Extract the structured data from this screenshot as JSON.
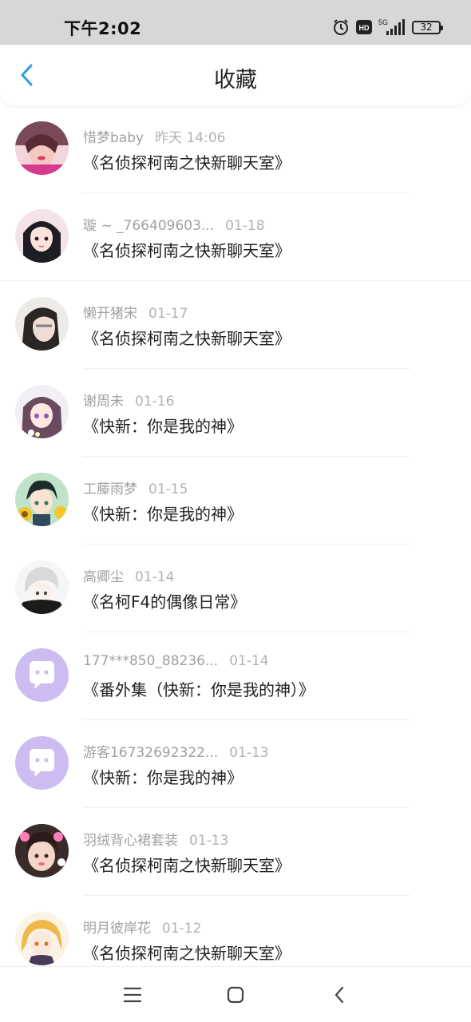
{
  "status_bar": {
    "time": "下午2:02",
    "network": "5G",
    "hd": "HD",
    "battery": "32"
  },
  "header": {
    "title": "收藏"
  },
  "colors": {
    "accent": "#2f9ae8",
    "title_text": "#222222",
    "meta_text": "#a0a0a0",
    "default_avatar": "#cdbcf2"
  },
  "items": [
    {
      "name": "惜梦baby",
      "date": "昨天 14:06",
      "title": "《名侦探柯南之快新聊天室》",
      "avatar": "photo-avatar"
    },
    {
      "name": "璇 ~ _766409603...",
      "date": "01-18",
      "title": "《名侦探柯南之快新聊天室》",
      "avatar": "anime-girl-avatar"
    },
    {
      "name": "懒开猪宋",
      "date": "01-17",
      "title": "《名侦探柯南之快新聊天室》",
      "avatar": "photo-avatar"
    },
    {
      "name": "谢周未",
      "date": "01-16",
      "title": "《快新：你是我的神》",
      "avatar": "anime-girl-avatar"
    },
    {
      "name": "工藤雨梦",
      "date": "01-15",
      "title": "《快新：你是我的神》",
      "avatar": "anime-boy-avatar"
    },
    {
      "name": "高卿尘",
      "date": "01-14",
      "title": "《名柯F4的偶像日常》",
      "avatar": "anime-boy-avatar"
    },
    {
      "name": "177***850_88236...",
      "date": "01-14",
      "title": "《番外集（快新：你是我的神）》",
      "avatar": "default-chat-avatar"
    },
    {
      "name": "游客16732692322...",
      "date": "01-13",
      "title": "《快新：你是我的神》",
      "avatar": "default-chat-avatar"
    },
    {
      "name": "羽绒背心裙套装",
      "date": "01-13",
      "title": "《名侦探柯南之快新聊天室》",
      "avatar": "photo-avatar"
    },
    {
      "name": "明月彼岸花",
      "date": "01-12",
      "title": "《名侦探柯南之快新聊天室》",
      "avatar": "anime-girl-avatar"
    }
  ],
  "nav_bar": {
    "buttons": [
      "menu-icon",
      "home-icon",
      "back-icon"
    ]
  }
}
